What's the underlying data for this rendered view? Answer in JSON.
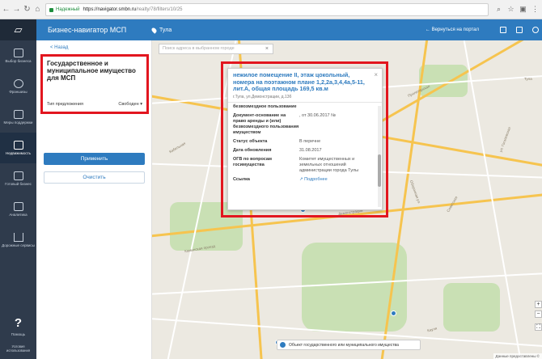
{
  "browser": {
    "secure_label": "Надежный",
    "url_host": "https://navigator.smbn.ru",
    "url_path": "/realty/78/filters/10/25",
    "back_icon": "arrow-left-icon",
    "forward_icon": "arrow-right-icon",
    "reload_icon": "reload-icon",
    "home_icon": "home-icon"
  },
  "leftnav": {
    "items": [
      {
        "label": "Выбор бизнеса"
      },
      {
        "label": "Франшизы"
      },
      {
        "label": "Меры поддержки"
      },
      {
        "label": "Недвижимость"
      },
      {
        "label": "Готовый бизнес"
      },
      {
        "label": "Аналитика"
      },
      {
        "label": "Дорожные сервисы"
      }
    ],
    "help_symbol": "?",
    "help_label": "Помощь",
    "terms_label": "Условия использования"
  },
  "topbar": {
    "title": "Бизнес-навигатор МСП",
    "city": "Тула",
    "back_to_portal": "←  Вернуться на портал"
  },
  "panel": {
    "back": "< Назад",
    "filter_title": "Государственное и муниципальное имущество для МСП",
    "offer_type_label": "Тип предложения",
    "offer_type_value": "Свободен",
    "apply": "Применить",
    "clear": "Очистить"
  },
  "map": {
    "search_placeholder": "Поиск адреса в выбранном городе",
    "search_clear": "×",
    "streets": [
      "Кабельная",
      "Оборонная ул.",
      "ул. Демонстрации",
      "Демонстрации",
      "Каминская проезд",
      "Советская",
      "Пролетарская",
      "ул. Гоголевская",
      "Кауля"
    ],
    "legend_text": "Объект государственного или муниципального имущества",
    "attribution": "Данные предоставлены ©",
    "city_marker": "Тула",
    "zoom_in": "+",
    "zoom_out": "−"
  },
  "popup": {
    "title": "нежилое помещение II, этаж цокольный, номера на поэтажном плане 1,2,2а,3,4,4а,5-11, лит.А, общая площадь 169,5 кв.м",
    "address": "г.Тула, ул.Демонстрации, д.13б",
    "close": "×",
    "rows": [
      {
        "key": "безвозмездное пользование",
        "value": ""
      },
      {
        "key": "Документ-основание на право аренды и (или) безвозмездного пользования имуществом",
        "value": ", от 30.06.2017 №"
      },
      {
        "key": "Статус объекта",
        "value": "В перечне"
      },
      {
        "key": "Дата обновления",
        "value": "31.08.2017"
      },
      {
        "key": "ОГВ по вопросам госимущества",
        "value": "Комитет имущественных и земельных отношений администрации города Тулы"
      },
      {
        "key": "Ссылка",
        "value": "↗ Подробнее",
        "link": true
      }
    ]
  }
}
